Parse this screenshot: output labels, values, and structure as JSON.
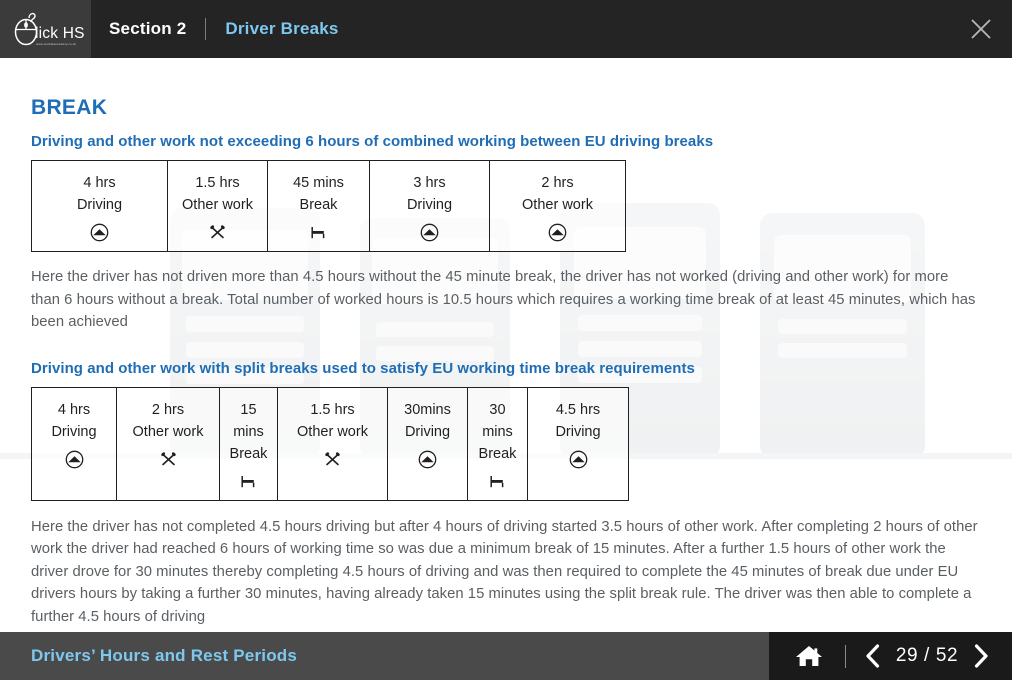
{
  "header": {
    "logo_text": "lick HSE",
    "logo_sub": "www.workplacesafety.co.uk",
    "logo_icon": "computer-mouse-icon",
    "section_label": "Section 2",
    "page_title": "Driver Breaks",
    "close_icon": "close-icon"
  },
  "content": {
    "heading": "BREAK",
    "section1": {
      "subheading": "Driving and other work not exceeding 6 hours of combined working between EU driving breaks",
      "table": [
        {
          "duration": "4 hrs",
          "activity": "Driving",
          "icon": "driving-icon"
        },
        {
          "duration": "1.5 hrs",
          "activity": "Other work",
          "icon": "other-work-icon"
        },
        {
          "duration": "45 mins",
          "activity": "Break",
          "icon": "break-icon"
        },
        {
          "duration": "3 hrs",
          "activity": "Driving",
          "icon": "driving-icon"
        },
        {
          "duration": "2 hrs",
          "activity": "Other work",
          "icon": "driving-icon"
        }
      ],
      "paragraph": "Here the driver has not driven more than 4.5 hours without the 45 minute break, the driver has not worked (driving and other work) for more than 6 hours without a break. Total number of worked hours is 10.5 hours which requires a working time break of at least 45 minutes, which has been achieved"
    },
    "section2": {
      "subheading": "Driving and other work with split breaks used to satisfy EU working time break requirements",
      "table": [
        {
          "duration": "4 hrs",
          "activity": "Driving",
          "icon": "driving-icon"
        },
        {
          "duration": "2 hrs",
          "activity": "Other work",
          "icon": "other-work-icon"
        },
        {
          "duration": "15\nmins",
          "activity": "Break",
          "icon": "break-icon"
        },
        {
          "duration": "1.5 hrs",
          "activity": "Other work",
          "icon": "other-work-icon"
        },
        {
          "duration": "30mins",
          "activity": "Driving",
          "icon": "driving-icon"
        },
        {
          "duration": "30\nmins",
          "activity": "Break",
          "icon": "break-icon"
        },
        {
          "duration": "4.5 hrs",
          "activity": "Driving",
          "icon": "driving-icon"
        }
      ],
      "paragraph": "Here the driver has not completed 4.5 hours driving but after 4 hours of driving started 3.5 hours of other work. After completing 2 hours of other work the driver had reached 6 hours of working time so was due a minimum break of 15 minutes. After a further 1.5 hours of other work the driver drove for 30 minutes thereby completing 4.5 hours of driving and was then required to complete the 45 minutes of break due under EU drivers hours by taking a further 30 minutes, having already taken 15 minutes using the split break rule. The driver was then able to complete a further 4.5 hours of driving"
    }
  },
  "footer": {
    "title": "Drivers’ Hours and Rest Periods",
    "home_icon": "home-icon",
    "prev_icon": "chevron-left-icon",
    "next_icon": "chevron-right-icon",
    "page_counter": "29 / 52",
    "current_page": 29,
    "total_pages": 52
  },
  "colors": {
    "header_bg": "#242424",
    "logo_bg": "#3b3b3b",
    "accent_blue": "#1f6db5",
    "title_blue": "#7ec8f0",
    "body_text": "#5a5f63",
    "footer_bg": "#4a4a4a",
    "footer_nav_bg": "#1a1a1a"
  }
}
